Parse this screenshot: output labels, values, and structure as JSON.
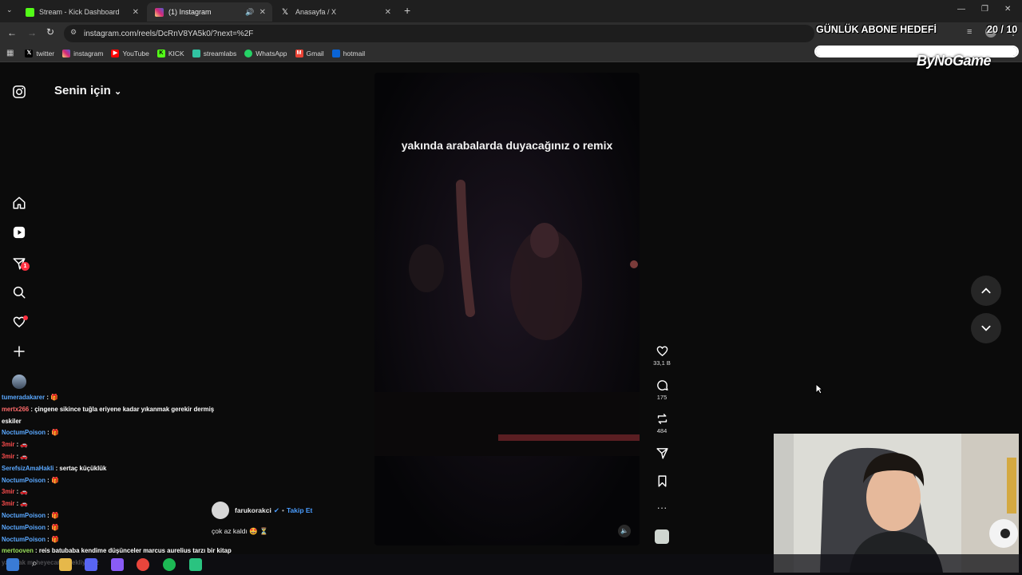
{
  "browser": {
    "tabs": [
      {
        "title": "Stream - Kick Dashboard",
        "active": false
      },
      {
        "title": "(1) Instagram",
        "active": true
      },
      {
        "title": "Anasayfa / X",
        "active": false
      }
    ],
    "url": "instagram.com/reels/DcRnV8YA5k0/?next=%2F",
    "bookmarks": [
      "twitter",
      "instagram",
      "YouTube",
      "KICK",
      "streamlabs",
      "WhatsApp",
      "Gmail",
      "hotmail"
    ]
  },
  "instagram": {
    "feed_title": "Senin için",
    "reel_caption": "yakında arabalarda duyacağınız o remix",
    "likes": "33,1 B",
    "comments": "175",
    "reposts": "484",
    "author": "farukorakci",
    "follow_label": "Takip Et",
    "post_caption": "çok az kaldı 🤩 ⏳",
    "notification_count": "1"
  },
  "overlay": {
    "goal_title": "GÜNLÜK ABONE HEDEFİ",
    "goal_count": "20 / 10",
    "goal_progress": 1.0,
    "brand": "ByNoGame"
  },
  "chat": [
    {
      "user": "tumeradakarer",
      "text": "🎁"
    },
    {
      "user": "mertx266",
      "text": "çingene sikince tuğla eriyene kadar yıkanmak gerekir dermiş eskiler"
    },
    {
      "user": "NoctumPoison",
      "text": "🎁"
    },
    {
      "user": "3mir",
      "text": "🚗"
    },
    {
      "user": "3mir",
      "text": "🚗"
    },
    {
      "user": "SerefsizAmaHakli",
      "text": "sertaç küçüklük"
    },
    {
      "user": "NoctumPoison",
      "text": "🎁"
    },
    {
      "user": "3mir",
      "text": "🚗"
    },
    {
      "user": "3mir",
      "text": "🚗"
    },
    {
      "user": "NoctumPoison",
      "text": "🎁"
    },
    {
      "user": "NoctumPoison",
      "text": "🎁"
    },
    {
      "user": "NoctumPoison",
      "text": "🎁"
    },
    {
      "user": "mertooven",
      "text": "reis batubaba kendime düşünceler marcus aurelius tarzı bir kitap yazacak mı heyecanla bekliyoruz"
    }
  ],
  "colors": {
    "instagram_red": "#ff3040",
    "follow_blue": "#4a9dff",
    "chat_user": "#5aa8ff"
  }
}
